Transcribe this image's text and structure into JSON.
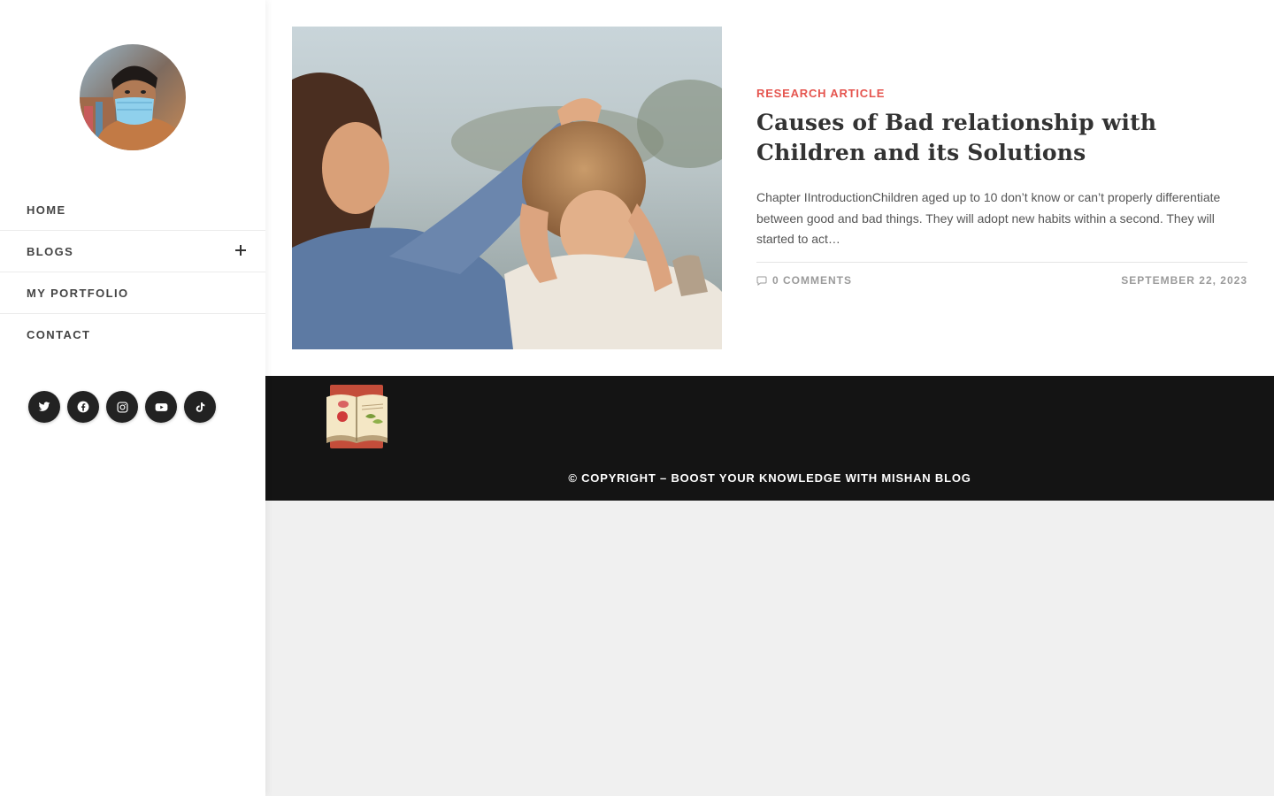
{
  "sidebar": {
    "avatar_alt": "profile photo",
    "nav": [
      {
        "label": "HOME",
        "has_submenu": false
      },
      {
        "label": "BLOGS",
        "has_submenu": true
      },
      {
        "label": "MY PORTFOLIO",
        "has_submenu": false
      },
      {
        "label": "CONTACT",
        "has_submenu": false
      }
    ],
    "socials": [
      "twitter-icon",
      "facebook-icon",
      "instagram-icon",
      "youtube-icon",
      "tiktok-icon"
    ]
  },
  "article": {
    "category": "RESEARCH ARTICLE",
    "title": "Causes of Bad relationship with Children and its Solutions",
    "excerpt": "Chapter IIntroductionChildren aged up to 10 don’t know or can’t properly differentiate between good and bad things. They will adopt new habits within a second. They will started to act…",
    "comments": "0 COMMENTS",
    "date": "SEPTEMBER 22, 2023"
  },
  "footer": {
    "copyright": "© COPYRIGHT – BOOST YOUR KNOWLEDGE WITH MISHAN BLOG"
  },
  "colors": {
    "accent": "#e5554f",
    "footer_bg": "#141414",
    "page_bg": "#f0f0f0",
    "social_bg": "#222222"
  }
}
